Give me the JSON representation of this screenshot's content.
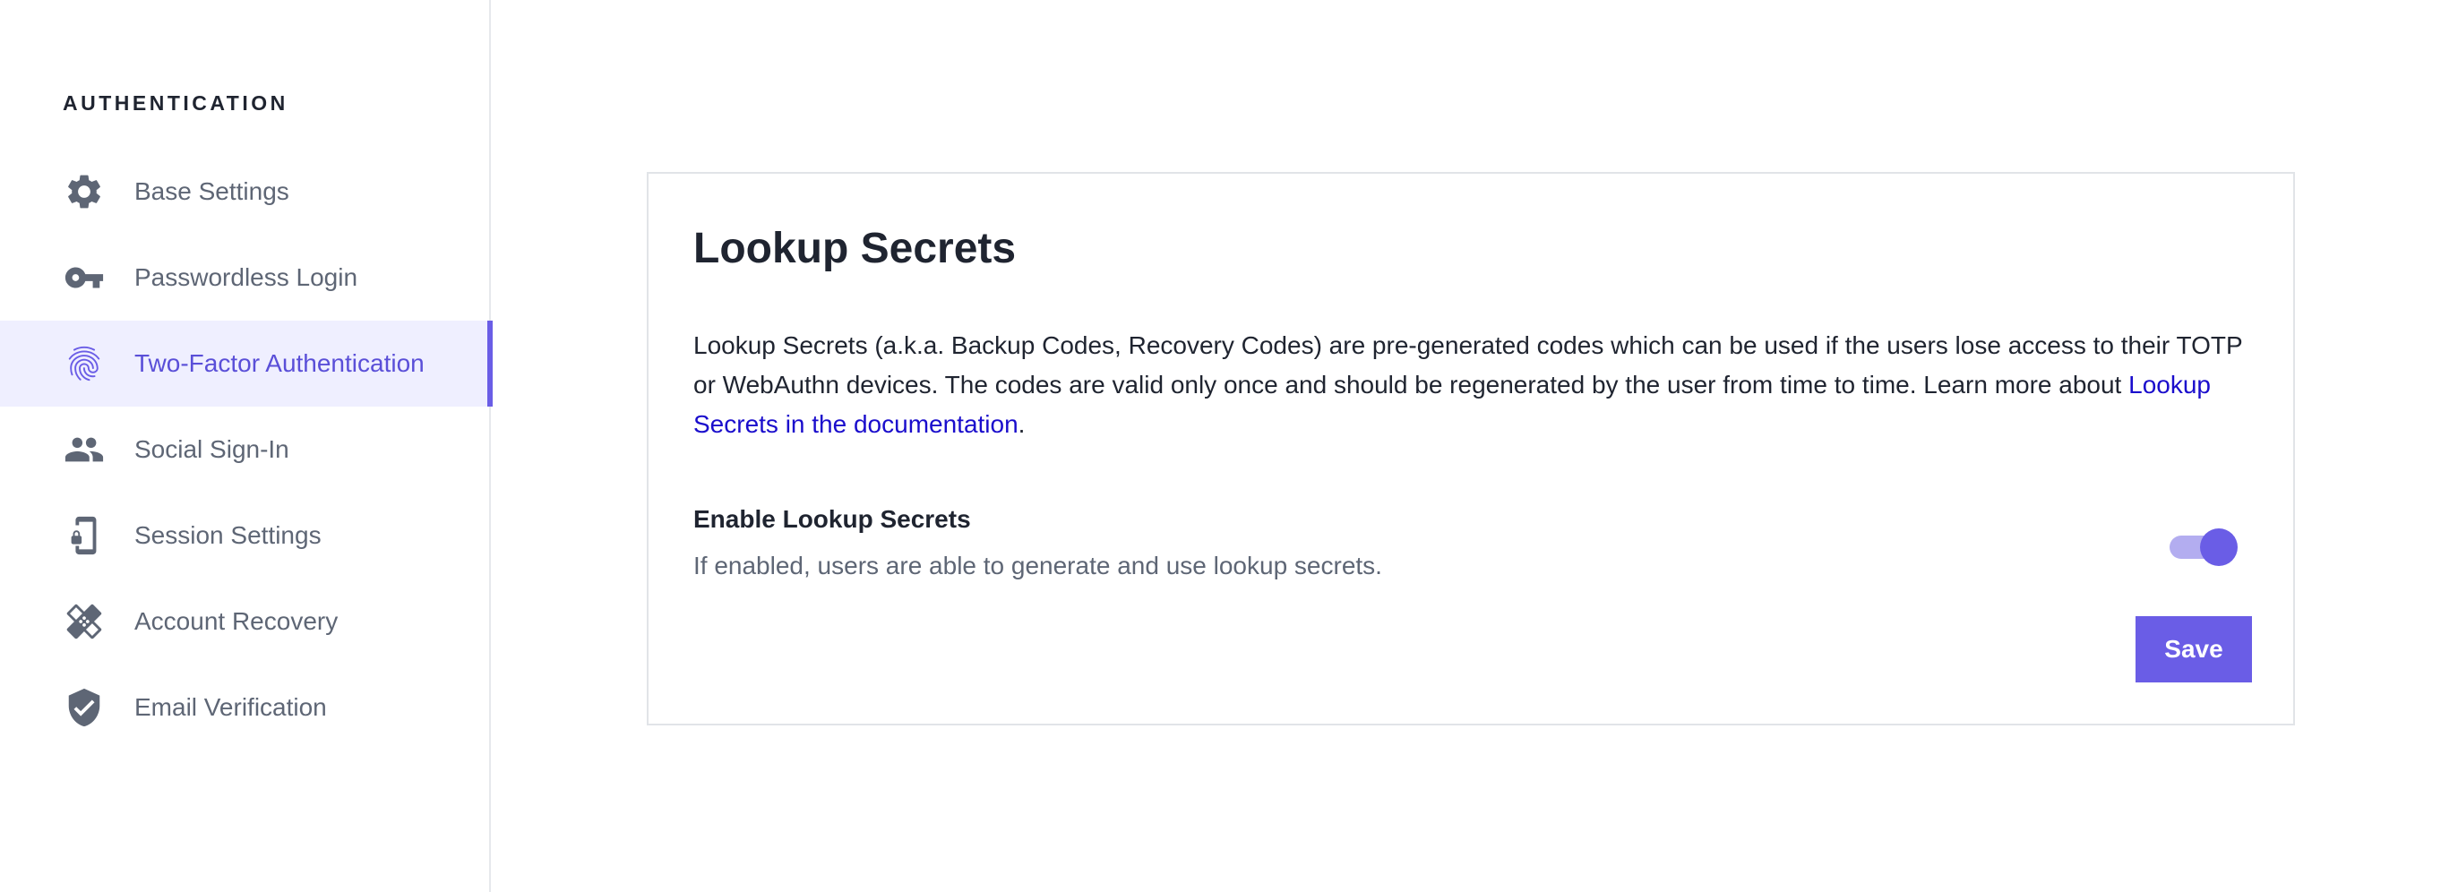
{
  "sidebar": {
    "heading": "AUTHENTICATION",
    "items": [
      {
        "label": "Base Settings",
        "icon": "gear-icon"
      },
      {
        "label": "Passwordless Login",
        "icon": "key-icon"
      },
      {
        "label": "Two-Factor Authentication",
        "icon": "fingerprint-icon",
        "active": true
      },
      {
        "label": "Social Sign-In",
        "icon": "people-icon"
      },
      {
        "label": "Session Settings",
        "icon": "phone-lock-icon"
      },
      {
        "label": "Account Recovery",
        "icon": "bandage-icon"
      },
      {
        "label": "Email Verification",
        "icon": "shield-check-icon"
      }
    ]
  },
  "card": {
    "title": "Lookup Secrets",
    "description": "Lookup Secrets (a.k.a. Backup Codes, Recovery Codes) are pre-generated codes which can be used if the users lose access to their TOTP or WebAuthn devices. The codes are valid only once and should be regenerated by the user from time to time. Learn more about ",
    "link_text": "Lookup Secrets in the documentation",
    "description_end": ".",
    "setting": {
      "title": "Enable Lookup Secrets",
      "help": "If enabled, users are able to generate and use lookup secrets.",
      "enabled": true
    },
    "save_label": "Save"
  },
  "colors": {
    "accent": "#6a5de6",
    "active_bg": "#efefff",
    "link": "#1a0dcc",
    "muted_text": "#5e6675"
  }
}
